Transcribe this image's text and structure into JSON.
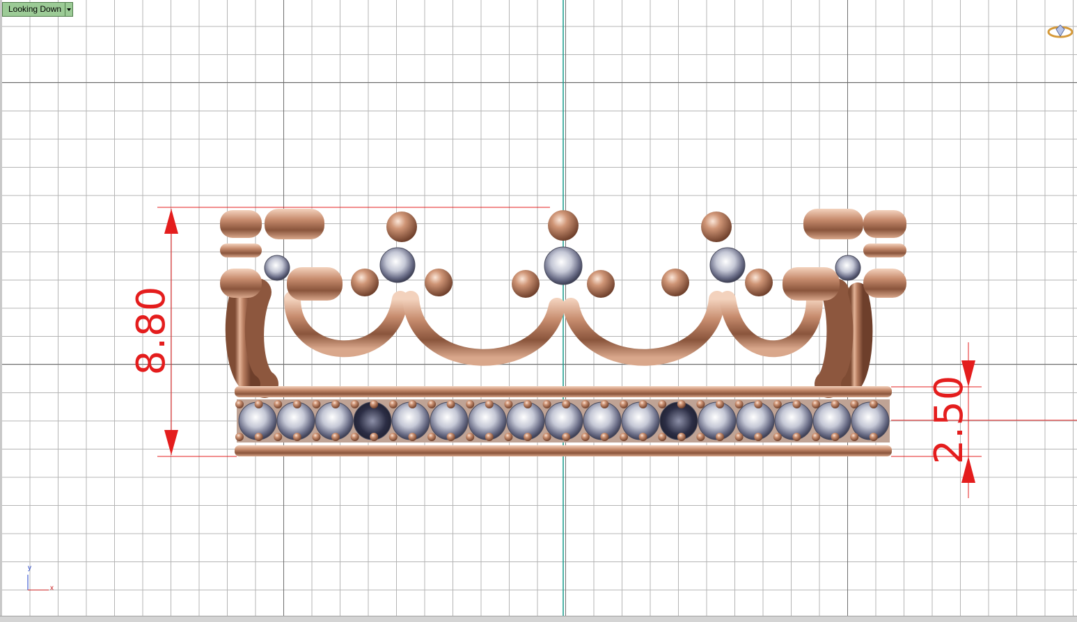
{
  "viewport": {
    "view_name": "Looking Down",
    "dimensions": {
      "height_total": "8.80",
      "band_height": "2.50"
    },
    "axis_labels": {
      "y": "y",
      "x": "x"
    },
    "colors": {
      "grid_major": "#6e6e6e",
      "grid_minor": "#b4b4b4",
      "axis_vertical": "#139a8a",
      "dimension": "#e41d1d",
      "gold": "#c28a6d",
      "label_bg": "#9ccb96"
    },
    "icons": {
      "view_menu": "chevron-down-icon",
      "brand": "ring-logo-icon"
    }
  }
}
